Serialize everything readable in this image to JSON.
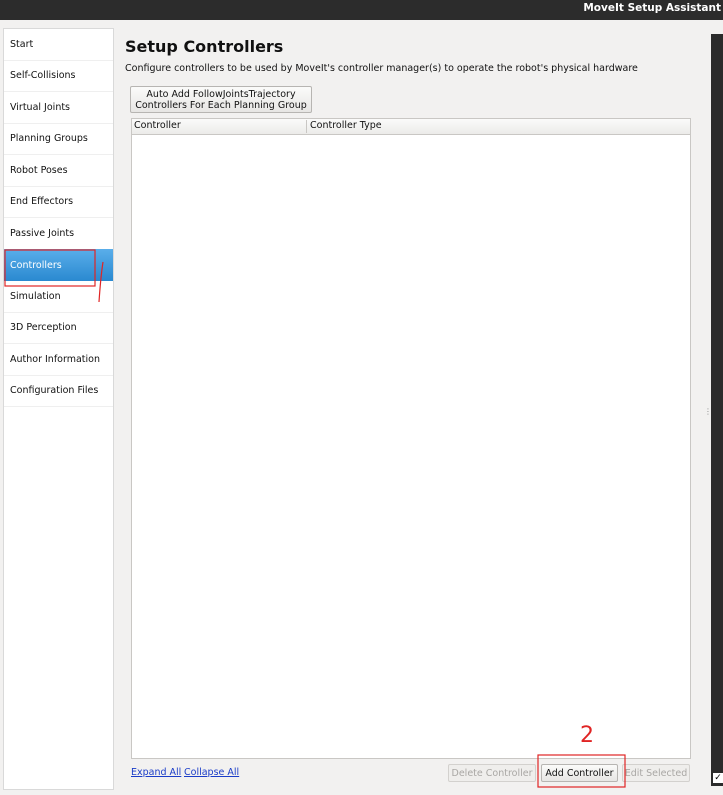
{
  "window": {
    "title": "MoveIt Setup Assistant"
  },
  "sidebar": {
    "items": [
      {
        "label": "Start"
      },
      {
        "label": "Self-Collisions"
      },
      {
        "label": "Virtual Joints"
      },
      {
        "label": "Planning Groups"
      },
      {
        "label": "Robot Poses"
      },
      {
        "label": "End Effectors"
      },
      {
        "label": "Passive Joints"
      },
      {
        "label": "Controllers",
        "selected": true
      },
      {
        "label": "Simulation"
      },
      {
        "label": "3D Perception"
      },
      {
        "label": "Author Information"
      },
      {
        "label": "Configuration Files"
      }
    ]
  },
  "main": {
    "title": "Setup Controllers",
    "description": "Configure controllers to be used by MoveIt's controller manager(s) to operate the robot's physical hardware",
    "auto_button": {
      "line1": "Auto Add FollowJointsTrajectory",
      "line2": "Controllers For Each Planning Group"
    },
    "table": {
      "columns": [
        "Controller",
        "Controller Type"
      ]
    },
    "links": {
      "expand_all": "Expand All",
      "collapse_all": "Collapse All"
    },
    "buttons": {
      "delete": "Delete Controller",
      "add": "Add Controller",
      "edit": "Edit Selected"
    }
  },
  "annotations": {
    "step2": "2"
  },
  "colors": {
    "selection_accent": "#2a89d0",
    "annotation_red": "#e02424",
    "link_blue": "#1a3cc8",
    "titlebar": "#2c2c2c"
  }
}
